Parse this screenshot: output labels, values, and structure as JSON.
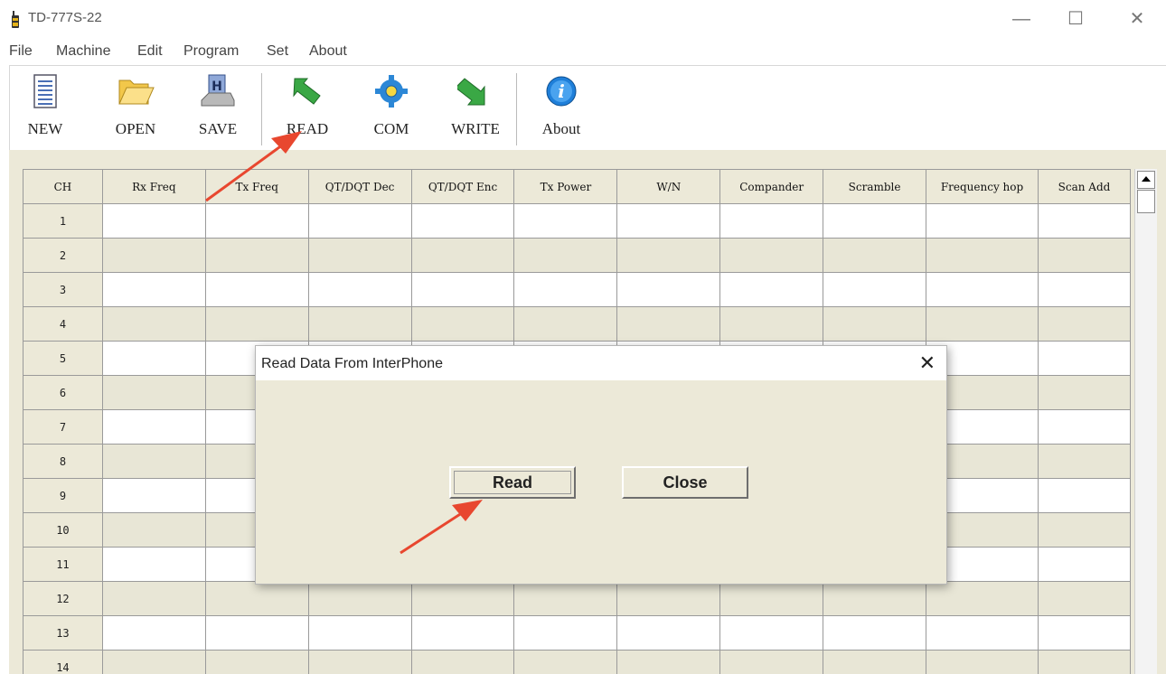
{
  "window": {
    "title": "TD-777S-22",
    "minimize": "—",
    "maximize": "☐",
    "close": "✕"
  },
  "menu": [
    "File",
    "Machine",
    "Edit",
    "Program",
    "Set",
    "About"
  ],
  "toolbar": [
    {
      "label": "NEW",
      "icon": "new-document-icon"
    },
    {
      "label": "OPEN",
      "icon": "open-folder-icon"
    },
    {
      "label": "SAVE",
      "icon": "save-disk-icon"
    },
    {
      "label": "READ",
      "icon": "read-arrow-icon"
    },
    {
      "label": "COM",
      "icon": "com-gear-icon"
    },
    {
      "label": "WRITE",
      "icon": "write-arrow-icon"
    },
    {
      "label": "About",
      "icon": "info-icon"
    }
  ],
  "grid": {
    "columns": [
      "CH",
      "Rx Freq",
      "Tx Freq",
      "QT/DQT Dec",
      "QT/DQT Enc",
      "Tx Power",
      "W/N",
      "Compander",
      "Scramble",
      "Frequency hop",
      "Scan Add"
    ],
    "rows": [
      "1",
      "2",
      "3",
      "4",
      "5",
      "6",
      "7",
      "8",
      "9",
      "10",
      "11",
      "12",
      "13",
      "14"
    ]
  },
  "dialog": {
    "title": "Read Data From InterPhone",
    "read_button": "Read",
    "close_button": "Close",
    "close_icon": "✕"
  },
  "colors": {
    "frame": "#ece9d8",
    "annotation_arrow": "#e8472f",
    "read_icon": "#3aa845",
    "info_icon": "#1f7fd9"
  }
}
